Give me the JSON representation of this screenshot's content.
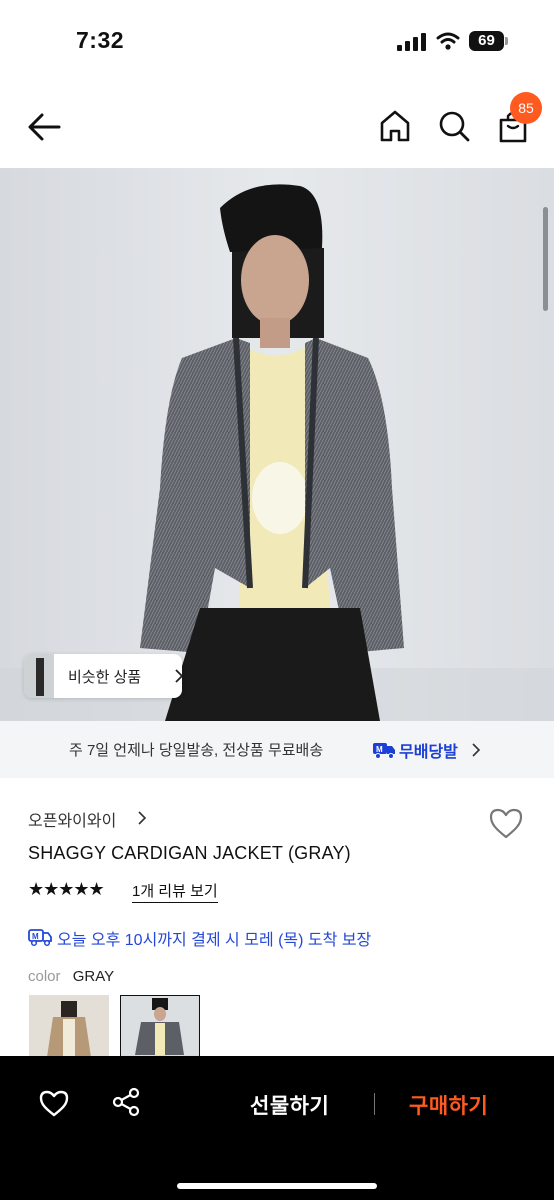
{
  "status_bar": {
    "time": "7:32",
    "battery": "69"
  },
  "header": {
    "cart_count": "85"
  },
  "hero": {
    "similar_label": "비슷한 상품"
  },
  "delivery_banner": {
    "text": "주 7일 언제나 당일발송, 전상품 무료배송",
    "brand": "무배당발"
  },
  "product": {
    "brand": "오픈와이와이",
    "title": "SHAGGY CARDIGAN JACKET (GRAY)",
    "stars": "★★★★★",
    "rating": 5,
    "review_link": "1개 리뷰 보기",
    "eta": "오늘 오후 10시까지 결제 시 모레 (목) 도착 보장",
    "color_label": "color",
    "color_value": "GRAY"
  },
  "bottom_bar": {
    "gift_label": "선물하기",
    "buy_label": "구매하기"
  },
  "colors": {
    "accent": "#ff5a1f",
    "delivery_blue": "#2548d8",
    "banner_bg": "#f4f5f7"
  }
}
